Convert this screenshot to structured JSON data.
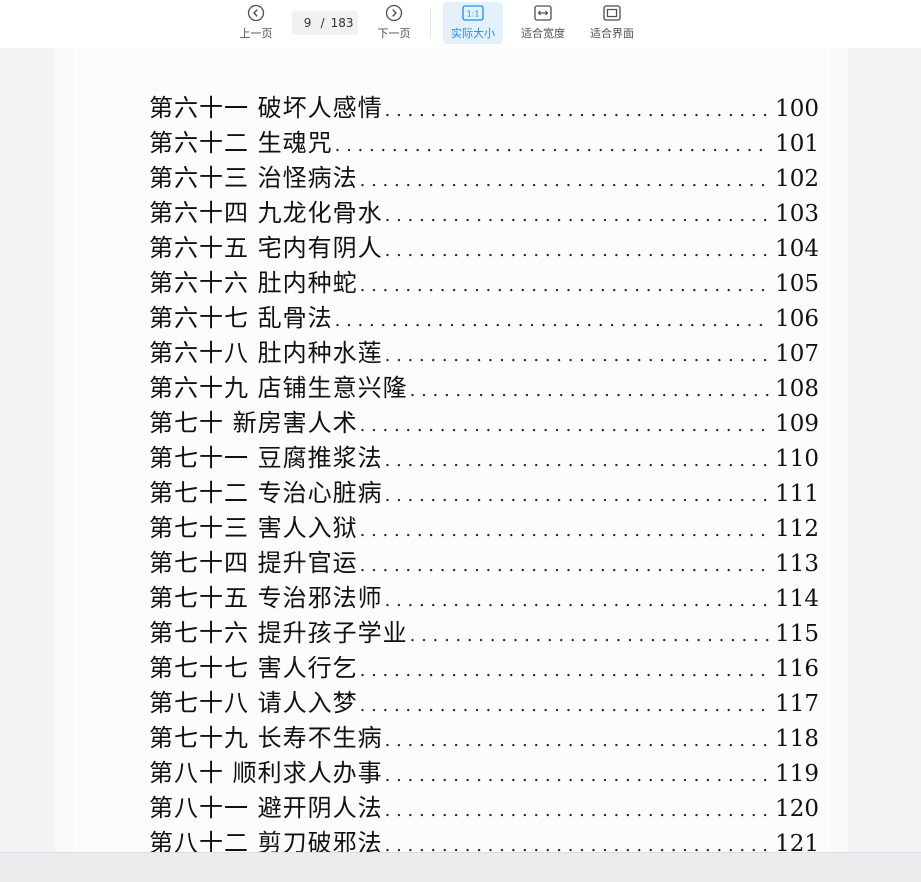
{
  "toolbar": {
    "prev_label": "上一页",
    "next_label": "下一页",
    "current_page": "9",
    "page_separator": "/",
    "total_pages": "183",
    "actual_size_label": "实际大小",
    "actual_size_icon_text": "1:1",
    "fit_width_label": "适合宽度",
    "fit_page_label": "适合界面",
    "accent_color": "#1e8ee8"
  },
  "toc": {
    "entries": [
      {
        "title": "第六十一  破坏人感情",
        "page": "100"
      },
      {
        "title": "第六十二  生魂咒",
        "page": "101"
      },
      {
        "title": "第六十三  治怪病法",
        "page": "102"
      },
      {
        "title": "第六十四  九龙化骨水",
        "page": "103"
      },
      {
        "title": "第六十五  宅内有阴人",
        "page": "104"
      },
      {
        "title": "第六十六  肚内种蛇",
        "page": "105"
      },
      {
        "title": "第六十七  乱骨法",
        "page": "106"
      },
      {
        "title": "第六十八  肚内种水莲",
        "page": "107"
      },
      {
        "title": "第六十九  店铺生意兴隆",
        "page": "108"
      },
      {
        "title": "第七十  新房害人术",
        "page": "109"
      },
      {
        "title": "第七十一  豆腐推浆法",
        "page": "110"
      },
      {
        "title": "第七十二  专治心脏病",
        "page": "111"
      },
      {
        "title": "第七十三  害人入狱",
        "page": "112"
      },
      {
        "title": "第七十四  提升官运",
        "page": "113"
      },
      {
        "title": "第七十五  专治邪法师",
        "page": "114"
      },
      {
        "title": "第七十六  提升孩子学业",
        "page": "115"
      },
      {
        "title": "第七十七  害人行乞",
        "page": "116"
      },
      {
        "title": "第七十八  请人入梦",
        "page": "117"
      },
      {
        "title": "第七十九  长寿不生病",
        "page": "118"
      },
      {
        "title": "第八十  顺利求人办事",
        "page": "119"
      },
      {
        "title": "第八十一  避开阴人法",
        "page": "120"
      },
      {
        "title": "第八十二  剪刀破邪法",
        "page": "121"
      }
    ]
  }
}
